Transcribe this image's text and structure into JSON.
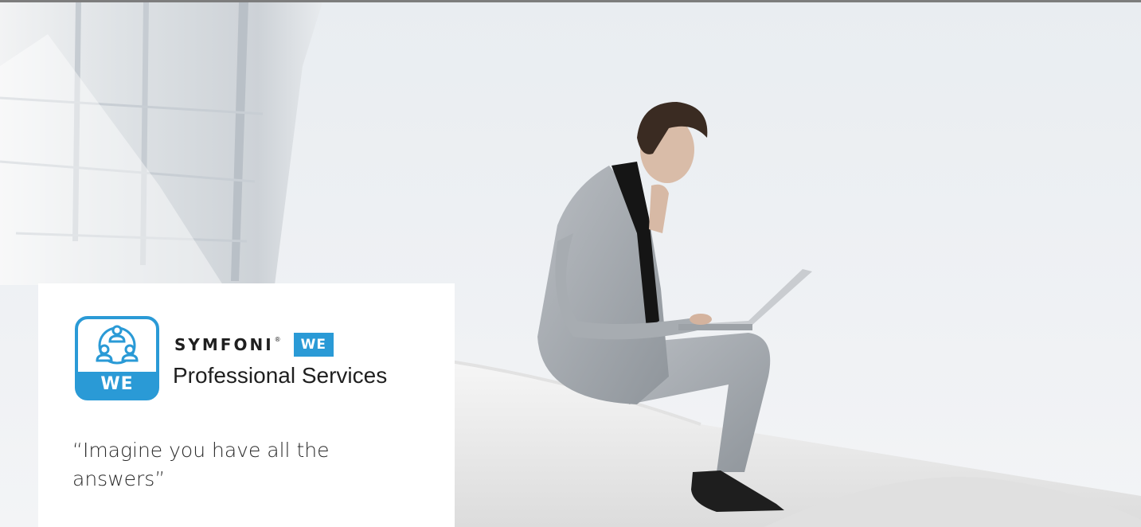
{
  "hero": {
    "image": "businessman-with-laptop-photo"
  },
  "promo": {
    "logo_icon": "people-network-icon",
    "logo_tile_label": "WE",
    "brand_name": "SYMFONI",
    "brand_mark": "®",
    "product_badge": "WE",
    "product_name": "Professional Services",
    "tagline": "“Imagine you have all the answers”"
  },
  "colors": {
    "accent_blue": "#2a9ad6",
    "top_rule": "#7d7d7d",
    "card_background": "#ffffff",
    "text_dark": "#1f1f1f"
  }
}
